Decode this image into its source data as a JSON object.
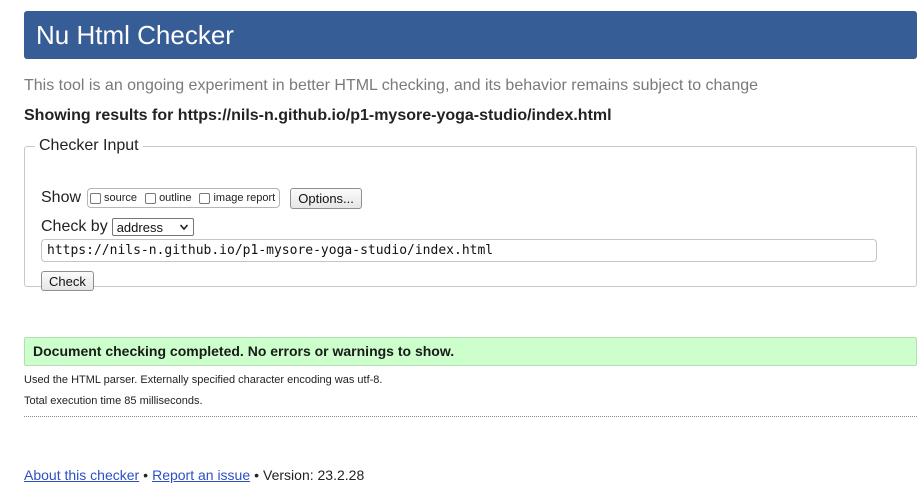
{
  "header": {
    "title": "Nu Html Checker"
  },
  "intro": "This tool is an ongoing experiment in better HTML checking, and its behavior remains subject to change",
  "results": {
    "showing_label": "Showing results for https://nils-n.github.io/p1-mysore-yoga-studio/index.html"
  },
  "checker_input": {
    "legend": "Checker Input",
    "show_label": "Show",
    "show_options": [
      {
        "label": "source"
      },
      {
        "label": "outline"
      },
      {
        "label": "image report"
      }
    ],
    "options_button": "Options...",
    "check_by_label": "Check by",
    "check_by_selected": "address",
    "url_value": "https://nils-n.github.io/p1-mysore-yoga-studio/index.html",
    "check_button": "Check"
  },
  "status": {
    "message": "Document checking completed. No errors or warnings to show.",
    "color": "#ccffcc"
  },
  "details": {
    "parser": "Used the HTML parser. Externally specified character encoding was utf-8.",
    "execution": "Total execution time 85 milliseconds."
  },
  "footer": {
    "about_link": "About this checker",
    "separator": "•",
    "report_link": "Report an issue",
    "version": "Version: 23.2.28"
  },
  "colors": {
    "header_bg": "#365d95",
    "link": "#2c4fc5"
  },
  "icons": {
    "select": "chevron-down-icon"
  }
}
